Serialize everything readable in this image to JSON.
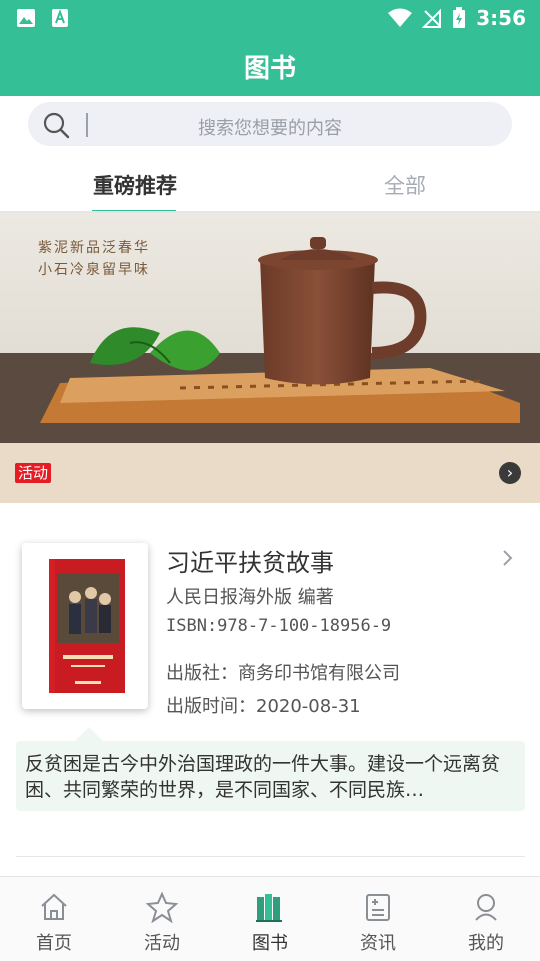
{
  "status_bar": {
    "time": "3:56"
  },
  "app_bar": {
    "title": "图书"
  },
  "search": {
    "placeholder": "搜索您想要的内容"
  },
  "tabs": [
    {
      "label": "重磅推荐",
      "active": true
    },
    {
      "label": "全部",
      "active": false
    }
  ],
  "banner": {
    "poem_line1": "紫泥新品泛春华",
    "poem_line2": "小石冷泉留早味",
    "tag": "活动"
  },
  "book": {
    "title": "习近平扶贫故事",
    "author": "人民日报海外版  编著",
    "isbn": "ISBN:978-7-100-18956-9",
    "publisher": "出版社：商务印书馆有限公司",
    "publish_date": "出版时间：2020-08-31",
    "description": "反贫困是古今中外治国理政的一件大事。建设一个远离贫困、共同繁荣的世界，是不同国家、不同民族…"
  },
  "bottom_nav": [
    {
      "label": "首页",
      "icon": "home-icon"
    },
    {
      "label": "活动",
      "icon": "star-icon"
    },
    {
      "label": "图书",
      "icon": "books-icon",
      "active": true
    },
    {
      "label": "资讯",
      "icon": "news-icon"
    },
    {
      "label": "我的",
      "icon": "user-icon"
    }
  ],
  "colors": {
    "primary": "#34bf96",
    "tag_red": "#e51c23"
  }
}
